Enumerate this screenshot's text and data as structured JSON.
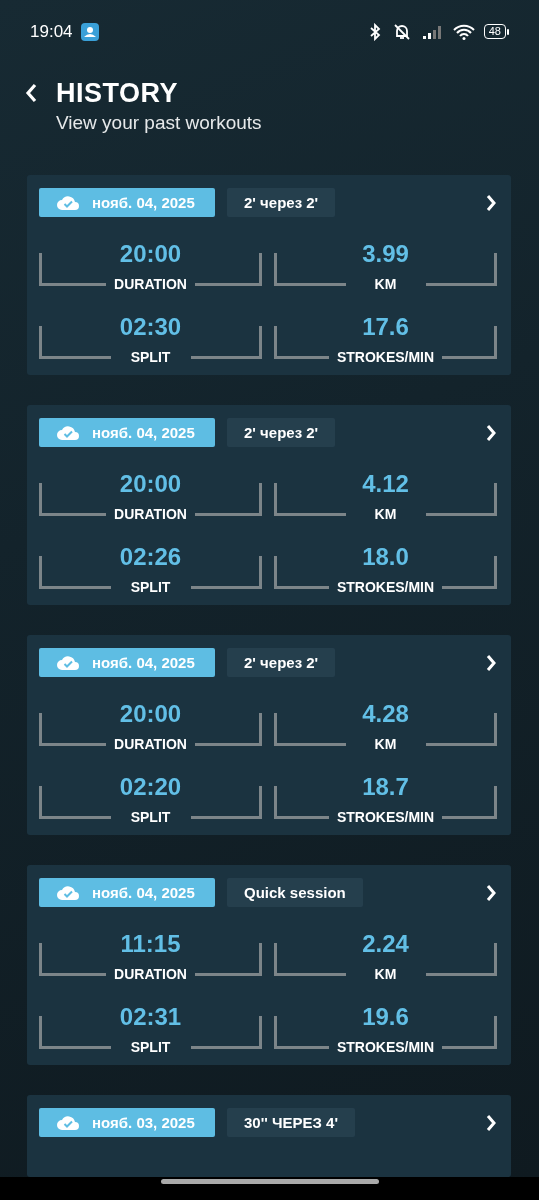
{
  "status_bar": {
    "time": "19:04",
    "battery": "48"
  },
  "header": {
    "title": "HISTORY",
    "subtitle": "View your past workouts"
  },
  "workouts": [
    {
      "date": "нояб. 04, 2025",
      "synced": true,
      "name": "2' через 2'",
      "metrics": [
        {
          "value": "20:00",
          "label": "DURATION"
        },
        {
          "value": "3.99",
          "label": "KM"
        },
        {
          "value": "02:30",
          "label": "SPLIT"
        },
        {
          "value": "17.6",
          "label": "STROKES/MIN"
        }
      ]
    },
    {
      "date": "нояб. 04, 2025",
      "synced": true,
      "name": "2' через 2'",
      "metrics": [
        {
          "value": "20:00",
          "label": "DURATION"
        },
        {
          "value": "4.12",
          "label": "KM"
        },
        {
          "value": "02:26",
          "label": "SPLIT"
        },
        {
          "value": "18.0",
          "label": "STROKES/MIN"
        }
      ]
    },
    {
      "date": "нояб. 04, 2025",
      "synced": true,
      "name": "2' через 2'",
      "metrics": [
        {
          "value": "20:00",
          "label": "DURATION"
        },
        {
          "value": "4.28",
          "label": "KM"
        },
        {
          "value": "02:20",
          "label": "SPLIT"
        },
        {
          "value": "18.7",
          "label": "STROKES/MIN"
        }
      ]
    },
    {
      "date": "нояб. 04, 2025",
      "synced": true,
      "name": "Quick session",
      "metrics": [
        {
          "value": "11:15",
          "label": "DURATION"
        },
        {
          "value": "2.24",
          "label": "KM"
        },
        {
          "value": "02:31",
          "label": "SPLIT"
        },
        {
          "value": "19.6",
          "label": "STROKES/MIN"
        }
      ]
    },
    {
      "date": "нояб. 03, 2025",
      "synced": true,
      "name": "30'' ЧЕРЕЗ 4'"
    }
  ]
}
